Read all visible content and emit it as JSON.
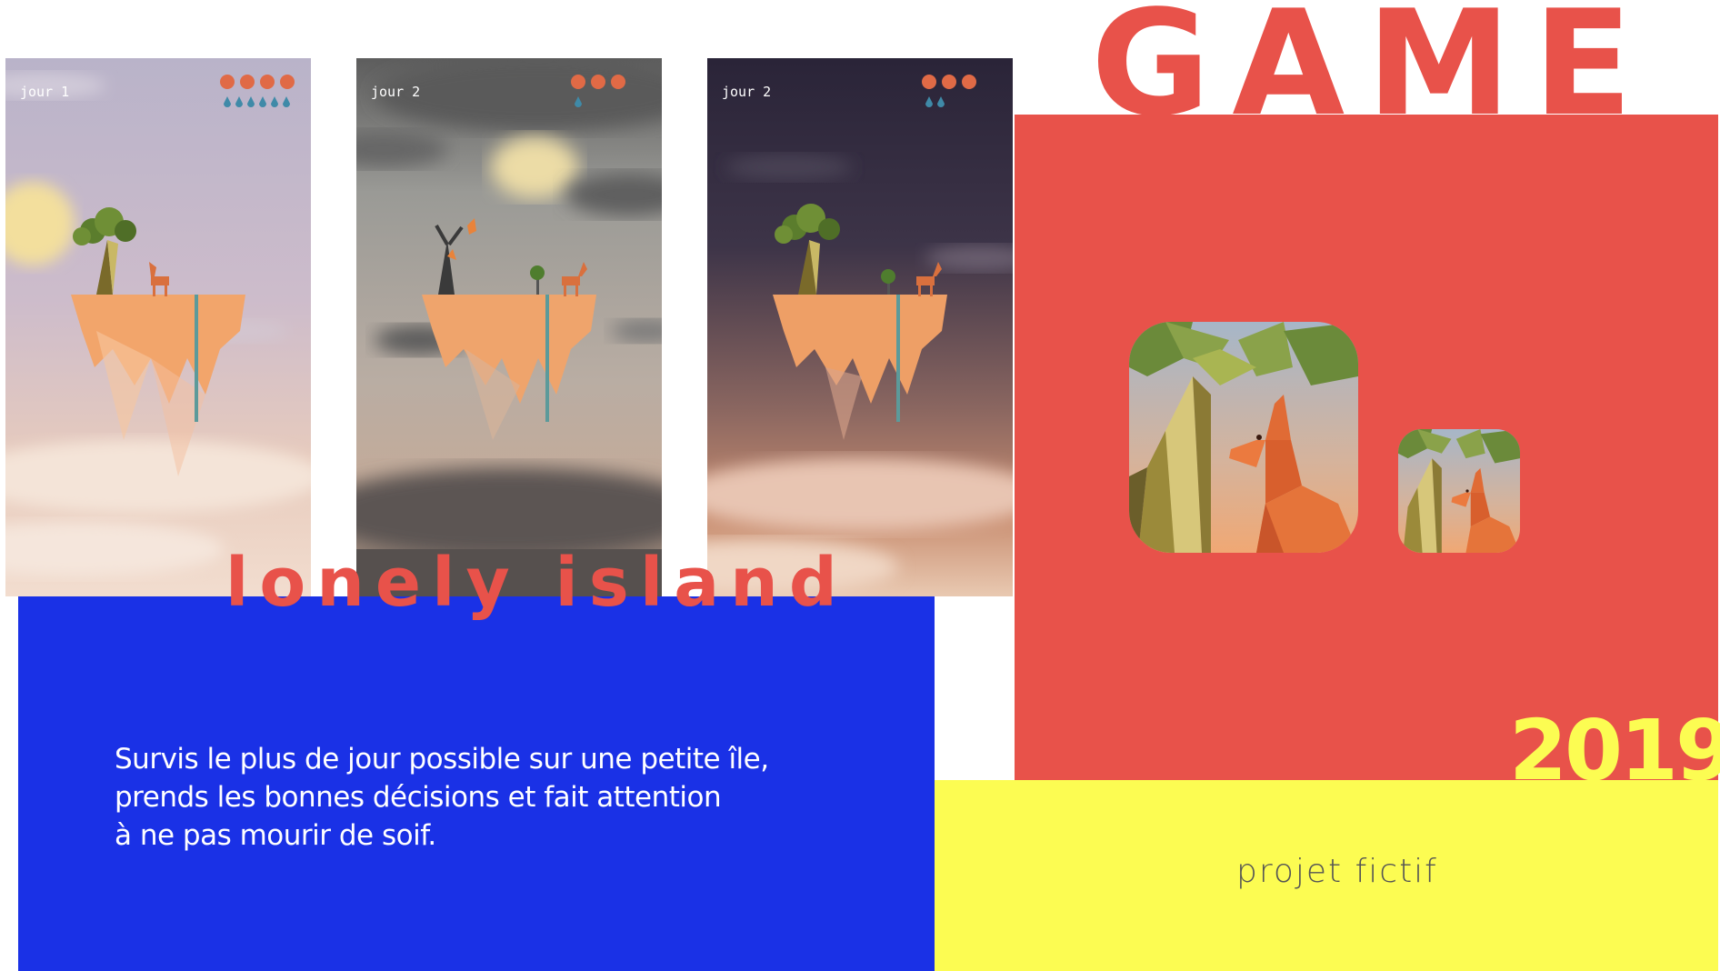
{
  "title": "GAME",
  "app_name": "lonely island",
  "year": "2019",
  "description": [
    "Survis le plus de jour possible sur une petite île,",
    "prends les bonnes décisions et fait attention",
    "à ne pas mourir de soif."
  ],
  "project_label": "projet fictif",
  "colors": {
    "red": "#e8524a",
    "blue": "#1a31e6",
    "yellow": "#fcfc52"
  },
  "screens": [
    {
      "day_label": "jour 1",
      "theme": "dusk-lilac"
    },
    {
      "day_label": "jour 2",
      "theme": "storm-grey"
    },
    {
      "day_label": "jour 2",
      "theme": "night-purple"
    }
  ],
  "icons": [
    "app-icon-large",
    "app-icon-small"
  ]
}
